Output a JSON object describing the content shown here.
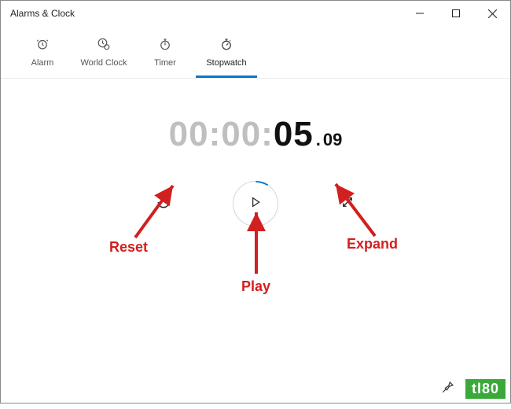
{
  "window": {
    "title": "Alarms & Clock"
  },
  "tabs": {
    "alarm": "Alarm",
    "world_clock": "World Clock",
    "timer": "Timer",
    "stopwatch": "Stopwatch"
  },
  "time": {
    "hours": "00",
    "c1": ":",
    "minutes": "00",
    "c2": ":",
    "seconds": "05",
    "dot": ".",
    "frac": "09"
  },
  "annotations": {
    "reset": "Reset",
    "play": "Play",
    "expand": "Expand"
  },
  "watermark": "tl80",
  "colors": {
    "accent": "#0078d4",
    "annotation": "#d21f1f"
  }
}
